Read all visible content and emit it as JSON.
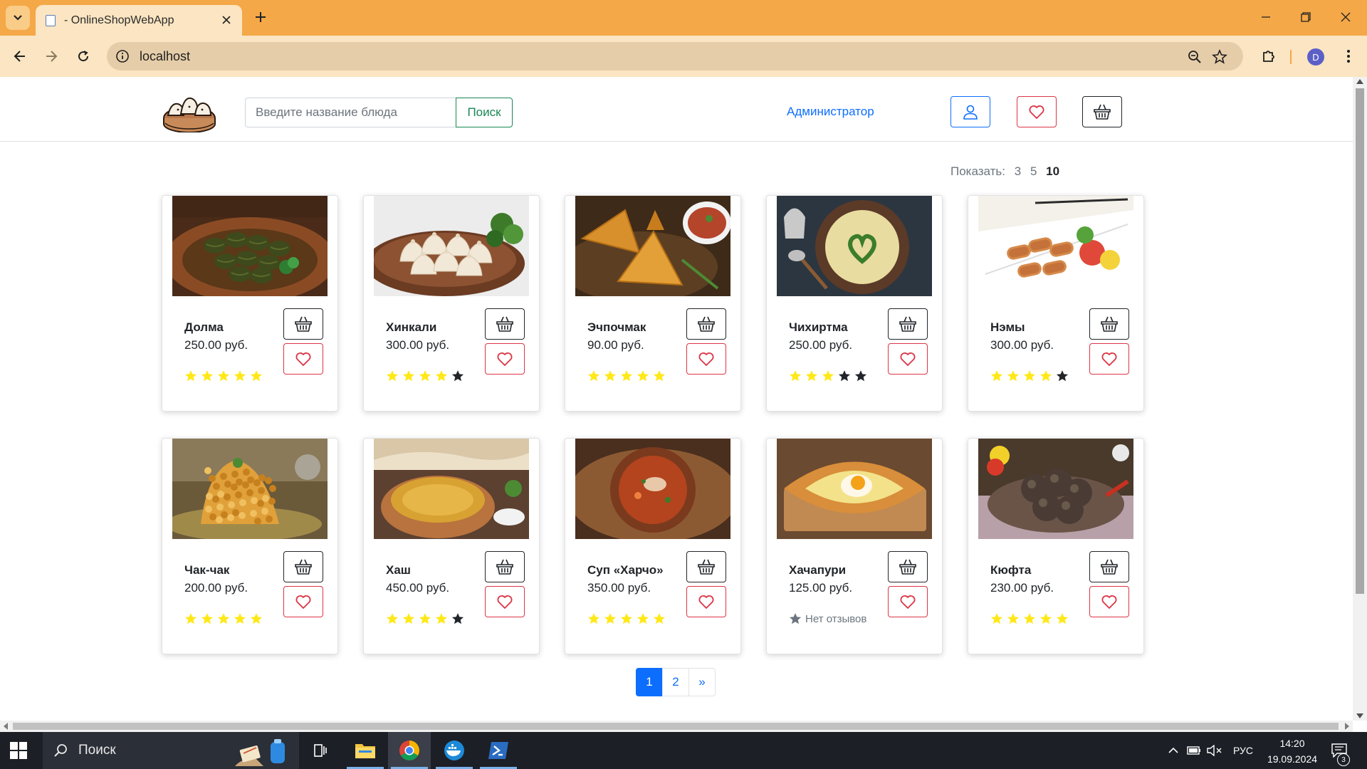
{
  "browser": {
    "tab_title": "- OnlineShopWebApp",
    "url": "localhost",
    "profile_initial": "D"
  },
  "header": {
    "search_placeholder": "Введите название блюда",
    "search_button": "Поиск",
    "admin_link": "Администратор"
  },
  "pagesize": {
    "label": "Показать:",
    "options": [
      "3",
      "5",
      "10"
    ],
    "selected": "10"
  },
  "products": [
    {
      "name": "Долма",
      "price": "250.00 руб.",
      "rating": 5,
      "image": "dolma-photo"
    },
    {
      "name": "Хинкали",
      "price": "300.00 руб.",
      "rating": 4,
      "image": "khinkali-photo"
    },
    {
      "name": "Эчпочмак",
      "price": "90.00 руб.",
      "rating": 5,
      "image": "echpochmak-photo"
    },
    {
      "name": "Чихиртма",
      "price": "250.00 руб.",
      "rating": 3,
      "image": "chikhirtma-photo"
    },
    {
      "name": "Нэмы",
      "price": "300.00 руб.",
      "rating": 4,
      "image": "nems-photo"
    },
    {
      "name": "Чак-чак",
      "price": "200.00 руб.",
      "rating": 5,
      "image": "chak-chak-photo"
    },
    {
      "name": "Хаш",
      "price": "450.00 руб.",
      "rating": 4,
      "image": "khash-photo"
    },
    {
      "name": "Суп «Харчо»",
      "price": "350.00 руб.",
      "rating": 5,
      "image": "kharcho-photo"
    },
    {
      "name": "Хачапури",
      "price": "125.00 руб.",
      "rating": null,
      "no_reviews": "Нет отзывов",
      "image": "khachapuri-photo"
    },
    {
      "name": "Кюфта",
      "price": "230.00 руб.",
      "rating": 5,
      "image": "kyufta-photo"
    }
  ],
  "pagination": {
    "pages": [
      "1",
      "2"
    ],
    "next": "»",
    "current": "1"
  },
  "taskbar": {
    "search_text": "Поиск",
    "language": "РУС",
    "time": "14:20",
    "date": "19.09.2024",
    "notifications": "3"
  },
  "colors": {
    "star_filled": "#ffe817",
    "star_empty": "#212529",
    "primary": "#0d6efd",
    "danger": "#dc3545",
    "success": "#198754",
    "chrome_tabstrip": "#f4a847"
  }
}
